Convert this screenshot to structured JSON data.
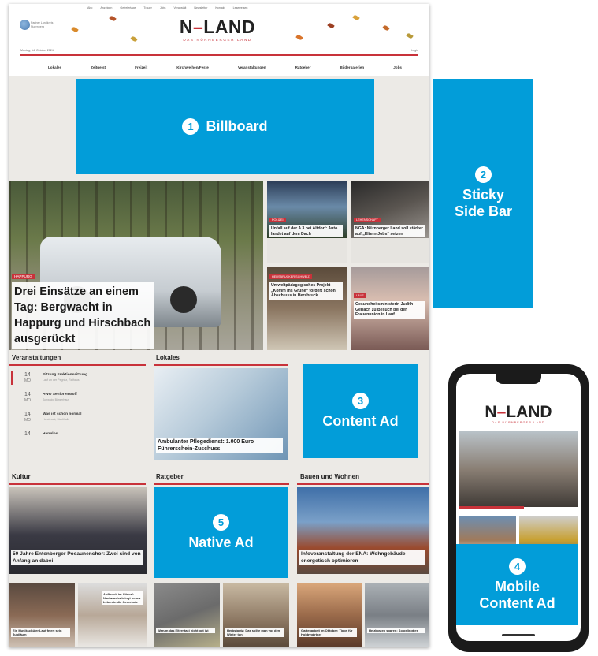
{
  "site": {
    "top_links": [
      "Abo",
      "Anzeigen",
      "Gefreiertage",
      "Trauer",
      "Jobs",
      "Veranstalt",
      "Newsletter",
      "Kontakt",
      "Leserreisen"
    ],
    "partner_text": "Partner Landkreis Nuernberg",
    "brand": {
      "name_left": "N",
      "dash": "–",
      "name_right": "LAND",
      "tagline": "DAS NÜRNBERGER LAND"
    },
    "date_line": "Montag, 14. Oktober 2024",
    "login": "Login",
    "nav": [
      "Lokales",
      "Zeitgeist",
      "Freizeit",
      "Kirchweihen/Feste",
      "Veranstaltungen",
      "Ratgeber",
      "Bildergalerien",
      "Jobs"
    ],
    "hero": {
      "category": "HAPPURG",
      "headline": "Drei Einsätze an einem Tag: Bergwacht in Happurg und Hirschbach ausgerückt"
    },
    "tiles": [
      {
        "category": "POLIZEI",
        "caption": "Unfall auf der A 3 bei Altdorf: Auto landet auf dem Dach"
      },
      {
        "category": "LEHENSCHAFT",
        "caption": "NGA: Nürnberger Land soll stärker auf „Eltern-Jobs“ setzen"
      },
      {
        "category": "HERSBRUCKER SCHWEIZ",
        "caption": "Umweltpädagogisches Projekt „Komm ins Grüne“ fördert schon Abschluss in Hersbruck"
      },
      {
        "category": "LAUF",
        "caption": "Gesundheitsministerin Judith Gerlach zu Besuch bei der Frauenunion in Lauf"
      }
    ],
    "sections": {
      "events": "Veranstaltungen",
      "lokales": "Lokales",
      "kultur": "Kultur",
      "ratgeber": "Ratgeber",
      "bauen": "Bauen und Wohnen"
    },
    "events": [
      {
        "day": "14",
        "month": "MO",
        "title": "Sitzung Fraktionssitzung",
        "sub": "Lauf an der Pegnitz, Rathaus"
      },
      {
        "day": "14",
        "month": "MO",
        "title": "AWO Seniorenstoff",
        "sub": "Schwaig, Bürgerhaus"
      },
      {
        "day": "14",
        "month": "MO",
        "title": "Was ist schon normal",
        "sub": "Hersbruck, Stadthalle"
      },
      {
        "day": "14",
        "month": "",
        "title": "Harmlos",
        "sub": ""
      }
    ],
    "lokales_caption": "Ambulanter Pflegedienst: 1.000 Euro Führerschein-Zuschuss",
    "kultur_caption": "50 Jahre Entenberger Posaunenchor: Zwei sind von Anfang an dabei",
    "bauen_caption": "Infoveranstaltung der ENA: Wohngebäude energetisch optimieren",
    "bottom_captions": [
      "Ein Musikschüler Lauf feiert sein Jubiläum",
      "Aufbruch im Altdorf: Nachwuchs bringt neues Leben in die Gemeinde",
      "Warum das Elterntaxi nicht gut ist",
      "Herbstputz: Das sollte man vor dem Winter tun",
      "Gartenarbeit im Oktober: Tipps für Hobbygärtner",
      "Heizkosten sparen: So gelingt es"
    ]
  },
  "ads": {
    "billboard": {
      "num": "1",
      "label": "Billboard"
    },
    "sticky": {
      "num": "2",
      "label_1": "Sticky",
      "label_2": "Side Bar"
    },
    "content": {
      "num": "3",
      "label": "Content Ad"
    },
    "mobile": {
      "num": "4",
      "label_1": "Mobile",
      "label_2": "Content Ad"
    },
    "native": {
      "num": "5",
      "label": "Native Ad"
    },
    "color": "#029dd9"
  },
  "mobile": {
    "brand": {
      "name_left": "N",
      "dash": "–",
      "name_right": "LAND",
      "tagline": "DAS NÜRNBERGER LAND"
    }
  },
  "colors": {
    "accent_red": "#c8323a",
    "page_bg": "#eceae6"
  }
}
